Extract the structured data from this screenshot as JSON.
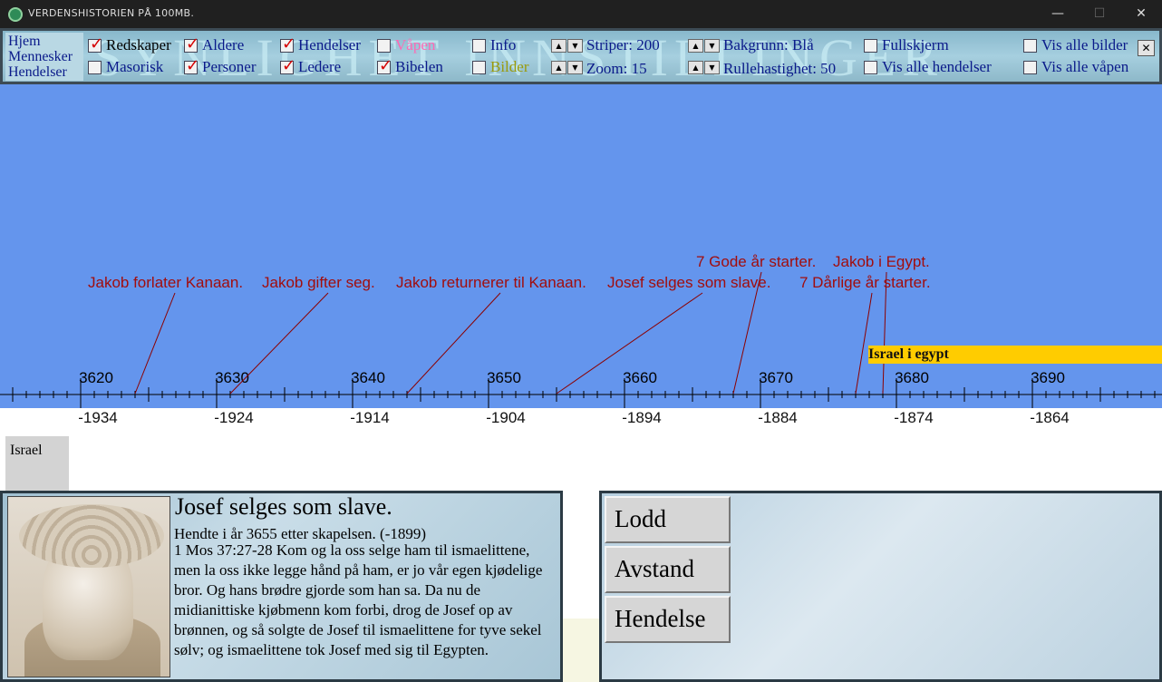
{
  "window": {
    "title": "VERDENSHISTORIEN PÅ 100MB.",
    "minimize_glyph": "—",
    "maximize_glyph": "☐",
    "close_glyph": "✕"
  },
  "toolbar": {
    "watermark": "SYNLIGHET INNSTILLINGER",
    "nav": [
      "Hjem",
      "Mennesker",
      "Hendelser"
    ],
    "checkboxes": [
      {
        "label": "Redskaper",
        "checked": true,
        "color": "#000000"
      },
      {
        "label": "Masorisk",
        "checked": false,
        "color": "#0a1a8a"
      },
      {
        "label": "Aldere",
        "checked": true,
        "color": "#0a1a8a"
      },
      {
        "label": "Personer",
        "checked": true,
        "color": "#0a1a8a"
      },
      {
        "label": "Hendelser",
        "checked": true,
        "color": "#0a1a8a"
      },
      {
        "label": "Ledere",
        "checked": true,
        "color": "#0a1a8a"
      },
      {
        "label": "Våpen",
        "checked": false,
        "color": "#ff69b4"
      },
      {
        "label": "Bibelen",
        "checked": true,
        "color": "#0a1a8a"
      },
      {
        "label": "Info",
        "checked": false,
        "color": "#0a1a8a"
      },
      {
        "label": "Bilder",
        "checked": false,
        "color": "#9a9a0a"
      },
      {
        "label": "Fullskjerm",
        "checked": false,
        "color": "#0a1a8a"
      },
      {
        "label": "Vis alle hendelser",
        "checked": false,
        "color": "#0a1a8a"
      },
      {
        "label": "Vis alle bilder",
        "checked": false,
        "color": "#0a1a8a"
      },
      {
        "label": "Vis alle våpen",
        "checked": false,
        "color": "#0a1a8a"
      }
    ],
    "spinners": {
      "striper": "Striper: 200",
      "zoom": "Zoom: 15",
      "bakgrunn": "Bakgrunn: Blå",
      "rullehastighet": "Rullehastighet: 50"
    },
    "spin_up": "▲",
    "spin_down": "▼",
    "close_glyph": "✕"
  },
  "timeline": {
    "background": "#6495ed",
    "years_am": [
      3620,
      3630,
      3640,
      3650,
      3660,
      3670,
      3680,
      3690
    ],
    "years_bc": [
      -1934,
      -1924,
      -1914,
      -1904,
      -1894,
      -1884,
      -1874,
      -1864
    ],
    "period": {
      "label": "Israel i egypt",
      "color": "#ffcc00"
    },
    "events_row1": [
      "7 Gode år starter.",
      "Jakob i Egypt."
    ],
    "events_row2": [
      "Jakob forlater Kanaan.",
      "Jakob gifter seg.",
      "Jakob returnerer til Kanaan.",
      "Josef selges som slave.",
      "7 Dårlige år starter."
    ],
    "event_years": [
      3624,
      3631,
      3644,
      3655,
      3668,
      3677,
      3679
    ]
  },
  "lower": {
    "region_tag": "Israel"
  },
  "info": {
    "title": "Josef selges som slave.",
    "date": "Hendte i år 3655 etter skapelsen. (-1899)",
    "body": "1 Mos 37:27-28  Kom og la oss selge ham til ismaelittene, men la oss ikke legge hånd på ham, er jo vår egen kjødelige bror. Og hans brødre gjorde som han sa. Da nu de midianittiske kjøbmenn kom forbi, drog de Josef op av brønnen, og så solgte de Josef til ismaelittene for tyve sekel sølv; og ismaelittene tok Josef med sig til Egypten."
  },
  "right_panel": {
    "buttons": [
      "Lodd",
      "Avstand",
      "Hendelse"
    ]
  }
}
